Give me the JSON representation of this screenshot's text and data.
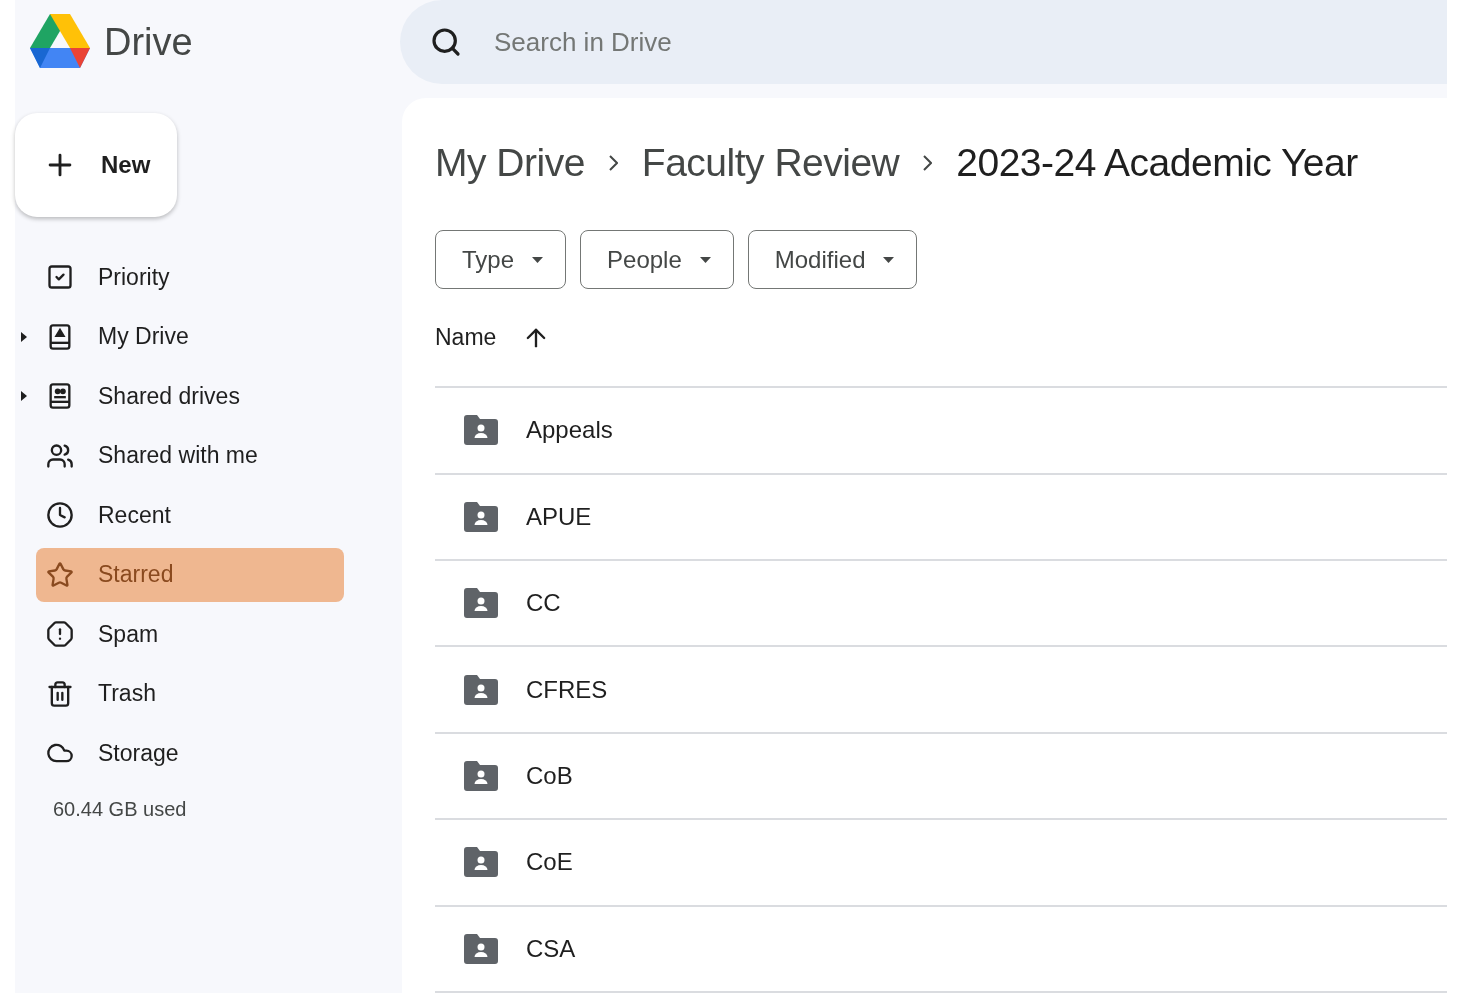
{
  "app": {
    "name": "Drive"
  },
  "search": {
    "placeholder": "Search in Drive"
  },
  "new_button": {
    "label": "New"
  },
  "sidebar": {
    "items": [
      {
        "label": "Priority",
        "kind": "priority",
        "expandable": false,
        "selected": false
      },
      {
        "label": "My Drive",
        "kind": "my-drive",
        "expandable": true,
        "selected": false
      },
      {
        "label": "Shared drives",
        "kind": "shared-drives",
        "expandable": true,
        "selected": false
      },
      {
        "label": "Shared with me",
        "kind": "shared",
        "expandable": false,
        "selected": false
      },
      {
        "label": "Recent",
        "kind": "recent",
        "expandable": false,
        "selected": false
      },
      {
        "label": "Starred",
        "kind": "starred",
        "expandable": false,
        "selected": true
      },
      {
        "label": "Spam",
        "kind": "spam",
        "expandable": false,
        "selected": false
      },
      {
        "label": "Trash",
        "kind": "trash",
        "expandable": false,
        "selected": false
      },
      {
        "label": "Storage",
        "kind": "storage",
        "expandable": false,
        "selected": false
      }
    ],
    "storage_used": "60.44 GB used"
  },
  "breadcrumb": [
    {
      "label": "My Drive",
      "current": false
    },
    {
      "label": "Faculty Review",
      "current": false
    },
    {
      "label": "2023-24 Academic Year",
      "current": true
    }
  ],
  "filters": [
    {
      "label": "Type"
    },
    {
      "label": "People"
    },
    {
      "label": "Modified"
    }
  ],
  "table": {
    "columns": [
      {
        "label": "Name",
        "sorted_ascending": true
      }
    ],
    "rows": [
      {
        "name": "Appeals",
        "kind": "shared-folder"
      },
      {
        "name": "APUE",
        "kind": "shared-folder"
      },
      {
        "name": "CC",
        "kind": "shared-folder"
      },
      {
        "name": "CFRES",
        "kind": "shared-folder"
      },
      {
        "name": "CoB",
        "kind": "shared-folder"
      },
      {
        "name": "CoE",
        "kind": "shared-folder"
      },
      {
        "name": "CSA",
        "kind": "shared-folder"
      }
    ]
  }
}
